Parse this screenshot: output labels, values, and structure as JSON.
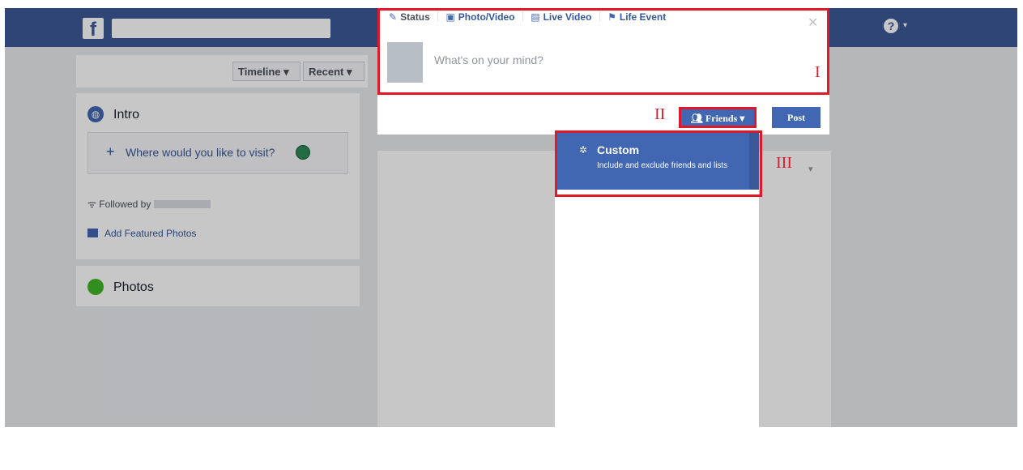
{
  "header": {
    "logo": "f",
    "help_icon": "?",
    "help_caret": "▾"
  },
  "filters": {
    "timeline_label": "Timeline ▾",
    "recent_label": "Recent ▾"
  },
  "intro": {
    "title": "Intro",
    "visit_plus": "+",
    "visit_text": "Where would you like to visit?",
    "followed_label": "Followed by",
    "featured_label": "Add Featured Photos"
  },
  "photos": {
    "title": "Photos"
  },
  "composer": {
    "tabs": {
      "status": "Status",
      "photo_video": "Photo/Video",
      "live_video": "Live Video",
      "life_event": "Life Event"
    },
    "placeholder": "What's on your mind?",
    "close_icon": "✕",
    "friends_label": "Friends ▾",
    "post_label": "Post"
  },
  "audience_menu": {
    "custom": {
      "title": "Custom",
      "description": "Include and exclude friends and lists"
    }
  },
  "annotations": {
    "I": "I",
    "II": "II",
    "III": "III"
  },
  "colors": {
    "brand": "#3b5998",
    "button": "#4267b2",
    "annotation": "#e0192a"
  }
}
